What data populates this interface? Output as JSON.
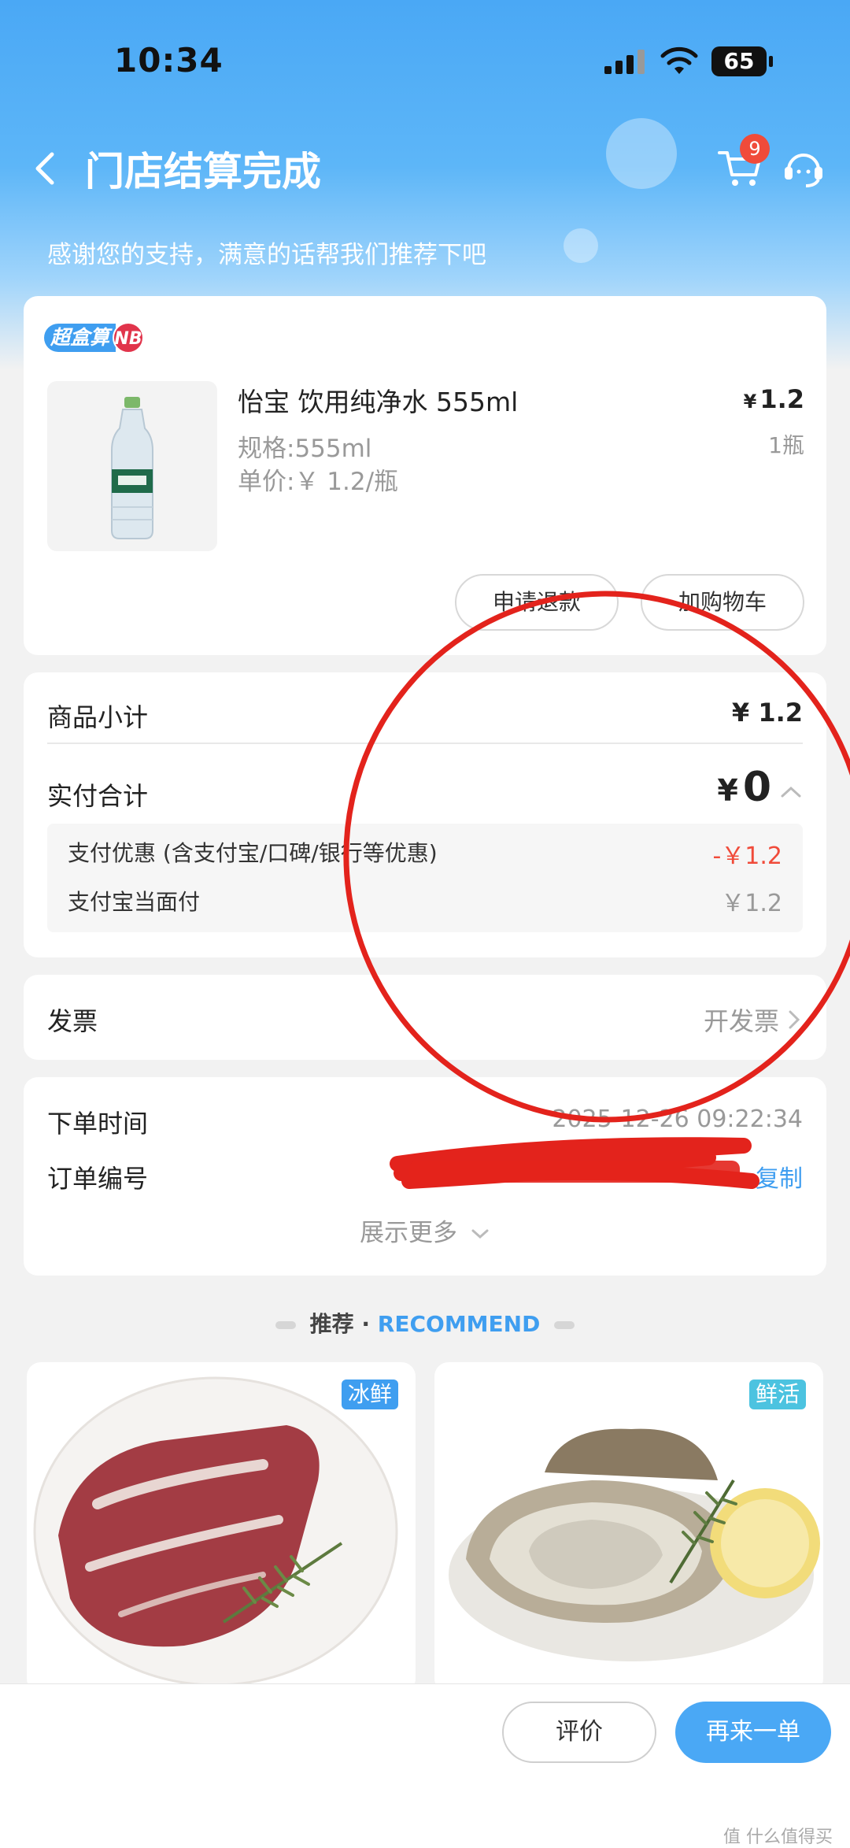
{
  "status_bar": {
    "time": "10:34",
    "battery": "65"
  },
  "nav": {
    "title": "门店结算完成",
    "cart_count": "9"
  },
  "thanks_text": "感谢您的支持，满意的话帮我们推荐下吧",
  "order_item": {
    "brand_tag": "超盒算",
    "brand_badge": "NB",
    "name": "怡宝 饮用纯净水 555ml",
    "spec": "规格:555ml",
    "unit_price": "单价:￥ 1.2/瓶",
    "price_symbol": "¥",
    "price": "1.2",
    "quantity": "1瓶",
    "refund_button": "申请退款",
    "add_cart_button": "加购物车"
  },
  "payment": {
    "subtotal_label": "商品小计",
    "subtotal_value": "¥ 1.2",
    "total_label": "实付合计",
    "total_symbol": "¥",
    "total_value": "0",
    "discount_label": "支付优惠 (含支付宝/口碑/银行等优惠)",
    "discount_value": "-￥1.2",
    "alipay_label": "支付宝当面付",
    "alipay_value": "￥1.2"
  },
  "invoice": {
    "label": "发票",
    "action": "开发票"
  },
  "order_info": {
    "time_label": "下单时间",
    "time_value": "2025-12-26 09:22:34",
    "number_label": "订单编号",
    "copy_label": "复制",
    "show_more": "展示更多"
  },
  "recommend": {
    "title_cn": "推荐 · ",
    "title_en": "RECOMMEND",
    "items": [
      {
        "tag": "冰鲜",
        "image": "beef-ribs-image"
      },
      {
        "tag": "鲜活",
        "image": "oyster-image"
      }
    ]
  },
  "bottom_bar": {
    "review_button": "评价",
    "reorder_button": "再来一单"
  },
  "watermark": "值 什么值得买",
  "colors": {
    "accent": "#3f9ef0",
    "discount_red": "#f04b3a",
    "annotation_red": "#e3231c"
  }
}
